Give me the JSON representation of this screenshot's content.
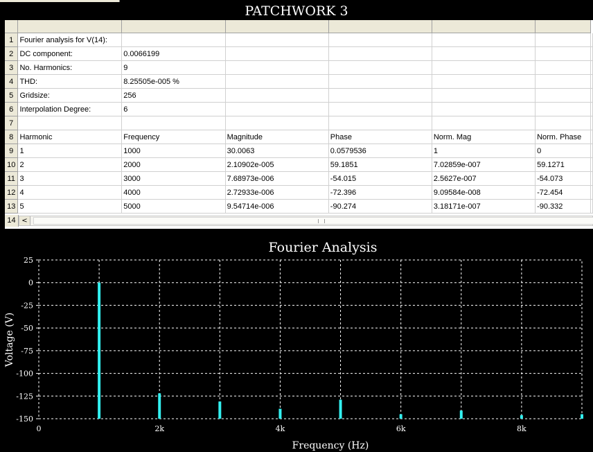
{
  "window": {
    "title": "PATCHWORK 3"
  },
  "grid": {
    "row_numbers": [
      "1",
      "2",
      "3",
      "4",
      "5",
      "6",
      "7",
      "8",
      "9",
      "10",
      "11",
      "12",
      "13",
      "14"
    ],
    "rows": [
      [
        "Fourier analysis for V(14):",
        "",
        "",
        "",
        "",
        ""
      ],
      [
        "DC component:",
        "0.0066199",
        "",
        "",
        "",
        ""
      ],
      [
        "No. Harmonics:",
        "9",
        "",
        "",
        "",
        ""
      ],
      [
        "THD:",
        "8.25505e-005 %",
        "",
        "",
        "",
        ""
      ],
      [
        "Gridsize:",
        "256",
        "",
        "",
        "",
        ""
      ],
      [
        "Interpolation Degree:",
        "6",
        "",
        "",
        "",
        ""
      ],
      [
        "",
        "",
        "",
        "",
        "",
        ""
      ],
      [
        "Harmonic",
        "Frequency",
        "Magnitude",
        "Phase",
        "Norm. Mag",
        "Norm. Phase"
      ],
      [
        "1",
        "1000",
        "30.0063",
        "0.0579536",
        "1",
        "0"
      ],
      [
        "2",
        "2000",
        "2.10902e-005",
        "59.1851",
        "7.02859e-007",
        "59.1271"
      ],
      [
        "3",
        "3000",
        "7.68973e-006",
        "-54.015",
        "2.5627e-007",
        "-54.073"
      ],
      [
        "4",
        "4000",
        "2.72933e-006",
        "-72.396",
        "9.09584e-008",
        "-72.454"
      ],
      [
        "5",
        "5000",
        "9.54714e-006",
        "-90.274",
        "3.18171e-007",
        "-90.332"
      ]
    ],
    "scroll_left_glyph": "<"
  },
  "chart_data": {
    "type": "bar",
    "title": "Fourier Analysis",
    "xlabel": "Frequency (Hz)",
    "ylabel": "Voltage (V)",
    "xlim": [
      0,
      9000
    ],
    "ylim": [
      -150,
      25
    ],
    "x_ticks": [
      {
        "value": 0,
        "label": "0"
      },
      {
        "value": 2000,
        "label": "2k"
      },
      {
        "value": 4000,
        "label": "4k"
      },
      {
        "value": 6000,
        "label": "6k"
      },
      {
        "value": 8000,
        "label": "8k"
      }
    ],
    "y_ticks": [
      {
        "value": 25,
        "label": "25"
      },
      {
        "value": 0,
        "label": "0"
      },
      {
        "value": -25,
        "label": "-25"
      },
      {
        "value": -50,
        "label": "-50"
      },
      {
        "value": -75,
        "label": "-75"
      },
      {
        "value": -100,
        "label": "-100"
      },
      {
        "value": -125,
        "label": "-125"
      },
      {
        "value": -150,
        "label": "-150"
      }
    ],
    "x": [
      1000,
      2000,
      3000,
      4000,
      5000,
      6000,
      7000,
      8000,
      9000
    ],
    "values": [
      0.1,
      -122,
      -131,
      -139,
      -129,
      -145,
      -141,
      -146,
      -145
    ],
    "grid": true,
    "bar_color": "#33f0f0",
    "grid_color": "#ffffff",
    "background": "#000000"
  }
}
